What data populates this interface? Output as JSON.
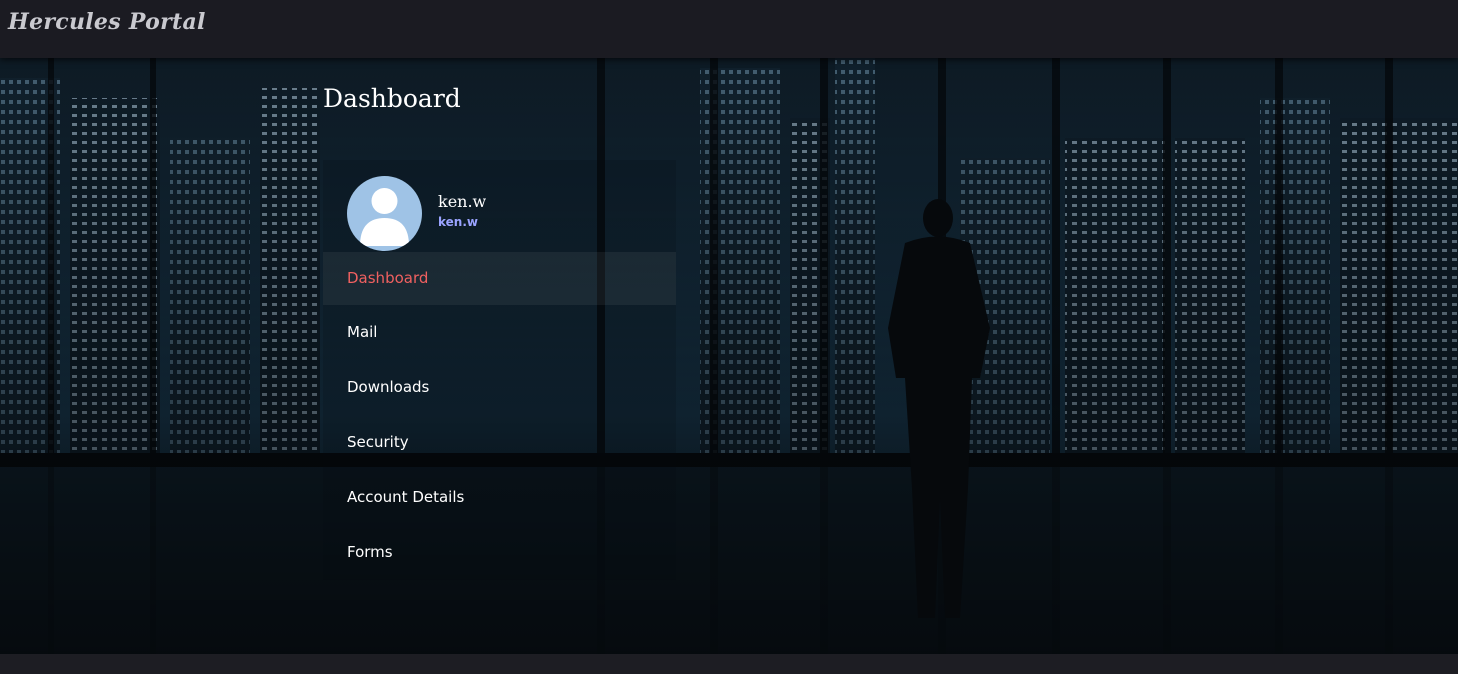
{
  "header": {
    "brand": "Hercules Portal"
  },
  "page": {
    "title": "Dashboard"
  },
  "user": {
    "name": "ken.w",
    "handle": "ken.w"
  },
  "nav": {
    "active_color": "#f06060",
    "items": [
      {
        "label": "Dashboard",
        "active": true
      },
      {
        "label": "Mail",
        "active": false
      },
      {
        "label": "Downloads",
        "active": false
      },
      {
        "label": "Security",
        "active": false
      },
      {
        "label": "Account Details",
        "active": false
      },
      {
        "label": "Forms",
        "active": false
      }
    ]
  },
  "background": {
    "description_icon": "city-skyline-background"
  }
}
